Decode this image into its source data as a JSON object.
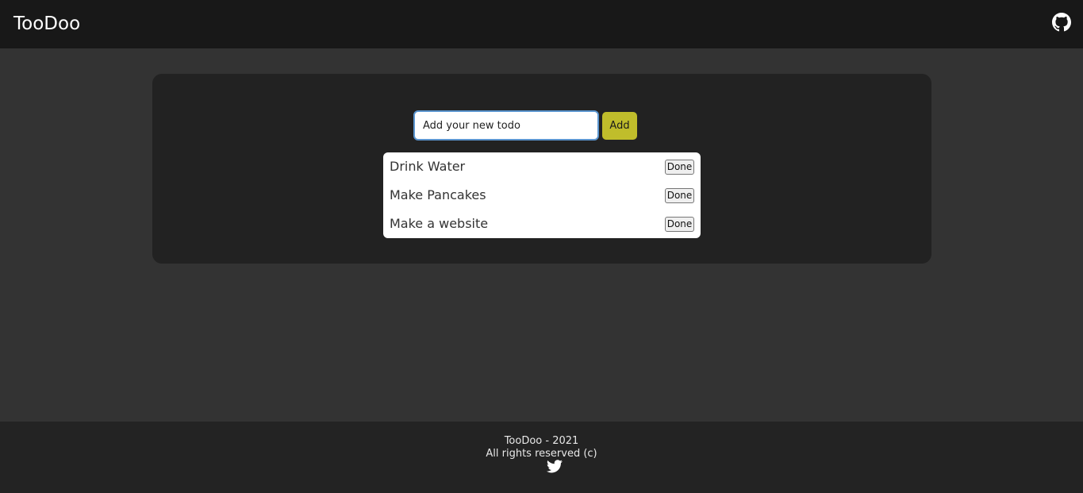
{
  "header": {
    "brand": "TooDoo",
    "github_icon": "github-icon"
  },
  "form": {
    "input_placeholder": "Add your new todo",
    "input_value": "",
    "add_label": "Add"
  },
  "todos": [
    {
      "text": "Drink Water",
      "done_label": "Done"
    },
    {
      "text": "Make Pancakes",
      "done_label": "Done"
    },
    {
      "text": "Make a website",
      "done_label": "Done"
    }
  ],
  "footer": {
    "line1": "TooDoo - 2021",
    "line2": "All rights reserved (c)",
    "twitter_icon": "twitter-icon"
  },
  "colors": {
    "header_bg": "#181818",
    "page_bg": "#333333",
    "card_bg": "#222222",
    "accent": "#c0bd2b",
    "input_border": "#5b95cf"
  }
}
